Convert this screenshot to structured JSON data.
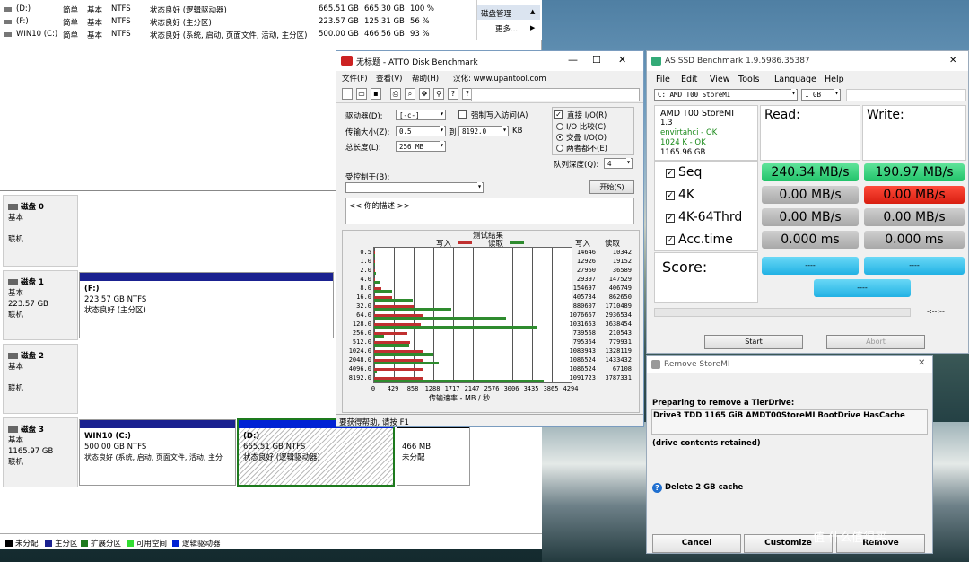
{
  "disk_mgmt": {
    "volumes": [
      {
        "name": "(D:)",
        "layout": "简单",
        "type": "基本",
        "fs": "NTFS",
        "status": "状态良好 (逻辑驱动器)",
        "capacity": "665.51 GB",
        "free": "665.30 GB",
        "pct": "100 %"
      },
      {
        "name": "(F:)",
        "layout": "简单",
        "type": "基本",
        "fs": "NTFS",
        "status": "状态良好 (主分区)",
        "capacity": "223.57 GB",
        "free": "125.31 GB",
        "pct": "56 %"
      },
      {
        "name": "WIN10 (C:)",
        "layout": "简单",
        "type": "基本",
        "fs": "NTFS",
        "status": "状态良好 (系统, 启动, 页面文件, 活动, 主分区)",
        "capacity": "500.00 GB",
        "free": "466.56 GB",
        "pct": "93 %"
      }
    ],
    "actions": {
      "header": "磁盘管理",
      "more": "更多..."
    },
    "disks": [
      {
        "name": "磁盘 0",
        "type": "基本",
        "state": "联机"
      },
      {
        "name": "磁盘 1",
        "type": "基本",
        "size": "223.57 GB",
        "state": "联机"
      },
      {
        "name": "磁盘 2",
        "type": "基本",
        "state": "联机"
      },
      {
        "name": "磁盘 3",
        "type": "基本",
        "size": "1165.97 GB",
        "state": "联机"
      }
    ],
    "partitions": {
      "f": {
        "name": "(F:)",
        "info": "223.57 GB NTFS",
        "status": "状态良好 (主分区)"
      },
      "c": {
        "name": "WIN10  (C:)",
        "info": "500.00 GB NTFS",
        "status": "状态良好 (系统, 启动, 页面文件, 活动, 主分"
      },
      "d": {
        "name": "(D:)",
        "info": "665.51 GB NTFS",
        "status": "状态良好 (逻辑驱动器)"
      },
      "u": {
        "info": "466 MB",
        "status": "未分配"
      }
    },
    "legend": [
      "未分配",
      "主分区",
      "扩展分区",
      "可用空间",
      "逻辑驱动器"
    ],
    "legend_colors": [
      "#000000",
      "#1a2190",
      "#1d7a1d",
      "#33dd33",
      "#0022d4"
    ]
  },
  "atto": {
    "title": "无标题 - ATTO Disk Benchmark",
    "menu": [
      "文件(F)",
      "查看(V)",
      "帮助(H)",
      "汉化: www.upantool.com"
    ],
    "drive_label": "驱动器(D):",
    "drive_value": "[-c-]",
    "force_write": "强制写入访问(A)",
    "direct_io": "直接 I/O(R)",
    "transfer_label": "传输大小(Z):",
    "transfer_from": "0.5",
    "to_label": "到",
    "transfer_to": "8192.0",
    "kb": "KB",
    "total_label": "总长度(L):",
    "total_value": "256 MB",
    "io_compare": "I/O 比较(C)",
    "io_overlap": "交叠 I/O(O)",
    "neither": "两者都不(E)",
    "queue_label": "队列深度(Q):",
    "queue_value": "4",
    "controlled": "受控制于(B):",
    "start": "开始(S)",
    "desc": "<<  你的描述  >>",
    "results_title": "测试结果",
    "write_legend": "写入",
    "read_legend": "读取",
    "col_write": "写入",
    "col_read": "读取",
    "xlabel": "传输速率 - MB / 秒",
    "status": "要获得帮助, 请按 F1"
  },
  "chart_data": {
    "type": "bar",
    "title": "测试结果",
    "xlabel": "传输速率 - MB / 秒",
    "xlim": [
      0,
      4294
    ],
    "xticks": [
      "0",
      "429",
      "858",
      "1288",
      "1717",
      "2147",
      "2576",
      "3006",
      "3435",
      "3865",
      "4294"
    ],
    "categories": [
      "0.5",
      "1.0",
      "2.0",
      "4.0",
      "8.0",
      "16.0",
      "32.0",
      "64.0",
      "128.0",
      "256.0",
      "512.0",
      "1024.0",
      "2048.0",
      "4096.0",
      "8192.0"
    ],
    "series": [
      {
        "name": "写入",
        "color": "#c03030",
        "values": [
          14646,
          12926,
          27950,
          29397,
          154697,
          405734,
          880607,
          1076667,
          1031663,
          739568,
          795364,
          1083943,
          1086524,
          1086524,
          1091723
        ]
      },
      {
        "name": "读取",
        "color": "#2e8b2e",
        "values": [
          10342,
          19152,
          36589,
          147529,
          406749,
          862650,
          1710489,
          2936534,
          3638454,
          210543,
          779931,
          1328119,
          1433432,
          67108,
          3787331
        ]
      }
    ],
    "unit": "KB/s"
  },
  "asssd": {
    "title": "AS SSD Benchmark 1.9.5986.35387",
    "menu": [
      "File",
      "Edit",
      "View",
      "Tools",
      "Language",
      "Help"
    ],
    "drive": "C: AMD T00 StoreMI",
    "size": "1 GB",
    "info": {
      "name": "AMD T00 StoreMI",
      "fw": "1.3",
      "driver": "envirtahci - OK",
      "align": "1024 K - OK",
      "cap": "1165.96 GB"
    },
    "read_hdr": "Read:",
    "write_hdr": "Write:",
    "rows": [
      {
        "name": "Seq",
        "read": "240.34 MB/s",
        "write": "190.97 MB/s"
      },
      {
        "name": "4K",
        "read": "0.00 MB/s",
        "write": "0.00 MB/s"
      },
      {
        "name": "4K-64Thrd",
        "read": "0.00 MB/s",
        "write": "0.00 MB/s"
      },
      {
        "name": "Acc.time",
        "read": "0.000 ms",
        "write": "0.000 ms"
      }
    ],
    "score_label": "Score:",
    "score_read": "----",
    "score_write": "----",
    "score_total": "----",
    "time": "-:--:--",
    "start": "Start",
    "abort": "Abort"
  },
  "storemi": {
    "title": "Remove StoreMI",
    "preparing": "Preparing to remove a TierDrive:",
    "drive_line": "Drive3   TDD  1165 GiB  AMDT00StoreMI BootDrive HasCache",
    "retained": "(drive contents retained)",
    "delete": "Delete 2 GB cache",
    "cancel": "Cancel",
    "customize": "Customize",
    "remove": "Remove"
  },
  "watermark": "值 什么值得买"
}
